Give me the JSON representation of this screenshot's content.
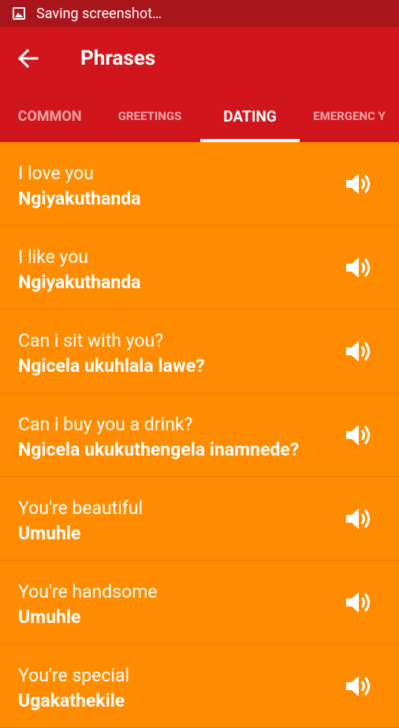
{
  "status_bar": {
    "text": "Saving screenshot…"
  },
  "app_bar": {
    "title": "Phrases"
  },
  "tabs": [
    {
      "label": "COMMON"
    },
    {
      "label": "GREETINGS"
    },
    {
      "label": "DATING"
    },
    {
      "label": "EMERGENC Y"
    }
  ],
  "phrases": [
    {
      "english": "I love you",
      "zulu": "Ngiyakuthanda"
    },
    {
      "english": "I like you",
      "zulu": "Ngiyakuthanda"
    },
    {
      "english": "Can i sit with you?",
      "zulu": "Ngicela ukuhlala lawe?"
    },
    {
      "english": "Can i buy you a drink?",
      "zulu": "Ngicela ukukuthengela inamnede?"
    },
    {
      "english": "You're beautiful",
      "zulu": "Umuhle"
    },
    {
      "english": "You're handsome",
      "zulu": "Umuhle"
    },
    {
      "english": "You're special",
      "zulu": "Ugakathekile"
    }
  ],
  "colors": {
    "status_bar": "#A8151A",
    "app_bar": "#D0161C",
    "list_bg": "#FF8C00"
  }
}
